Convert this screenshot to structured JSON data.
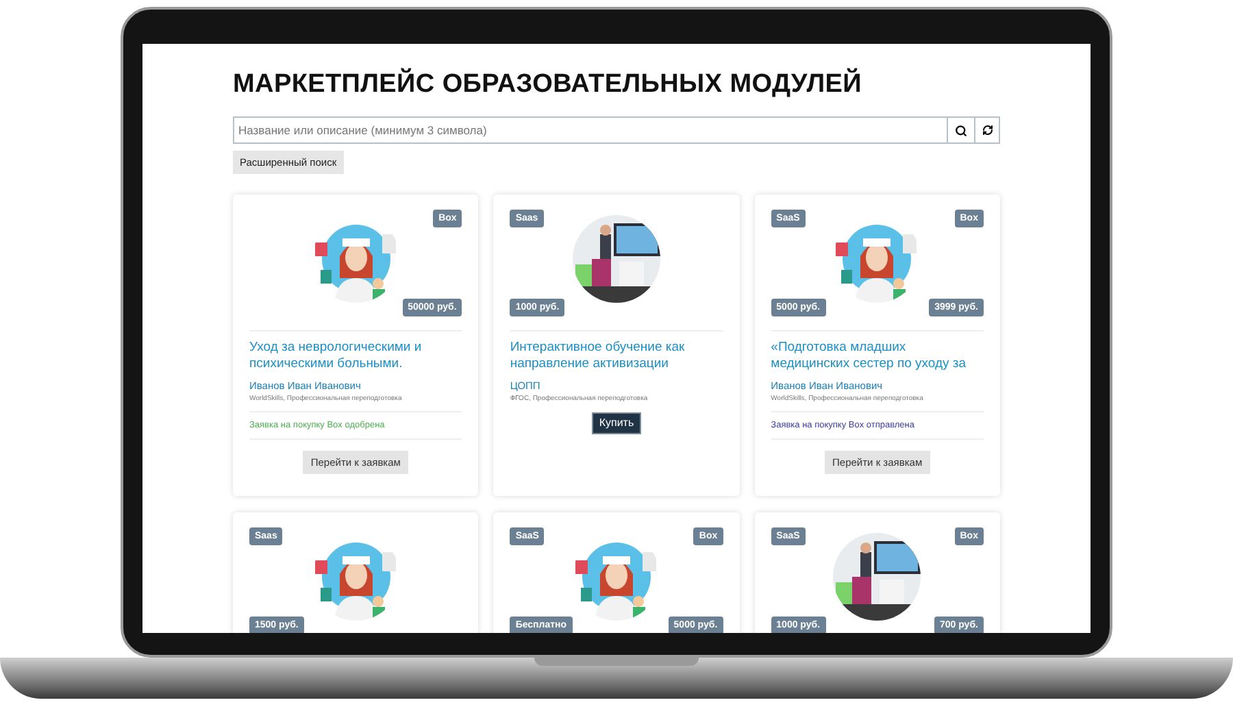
{
  "page": {
    "title": "МАРКЕТПЛЕЙС ОБРАЗОВАТЕЛЬНЫХ МОДУЛЕЙ"
  },
  "search": {
    "placeholder": "Название или описание (минимум 3 символа)",
    "advanced_button": "Расширенный поиск"
  },
  "cards": [
    {
      "badge_top_right": "Box",
      "badge_bottom_right": "50000 руб.",
      "title": "Уход за неврологическими и психическими больными.",
      "author": "Иванов Иван Иванович",
      "subtitle": "WorldSkills, Профессиональная переподготовка",
      "status": {
        "kind": "approved",
        "text": "Заявка на покупку Box одобрена"
      },
      "button": {
        "kind": "secondary",
        "label": "Перейти к заявкам"
      }
    },
    {
      "badge_top_left": "Saas",
      "badge_bottom_left": "1000 руб.",
      "title": "Интерактивное обучение как направление активизации",
      "author": "ЦОПП",
      "subtitle": "ФГОС, Профессиональная переподготовка",
      "button": {
        "kind": "primary",
        "label": "Купить"
      }
    },
    {
      "badge_top_left": "SaaS",
      "badge_top_right": "Box",
      "badge_bottom_left": "5000 руб.",
      "badge_bottom_right": "3999 руб.",
      "title": "«Подготовка младших медицинских сестер по уходу за",
      "author": "Иванов Иван Иванович",
      "subtitle": "WorldSkills, Профессиональная переподготовка",
      "status": {
        "kind": "sent",
        "text": "Заявка на покупку Box отправлена"
      },
      "button": {
        "kind": "secondary",
        "label": "Перейти к заявкам"
      }
    },
    {
      "badge_top_left": "Saas",
      "badge_bottom_left": "1500 руб."
    },
    {
      "badge_top_left": "SaaS",
      "badge_top_right": "Box",
      "badge_bottom_left": "Бесплатно",
      "badge_bottom_right": "5000 руб."
    },
    {
      "badge_top_left": "SaaS",
      "badge_top_right": "Box",
      "badge_bottom_left": "1000 руб.",
      "badge_bottom_right": "700 руб."
    }
  ]
}
